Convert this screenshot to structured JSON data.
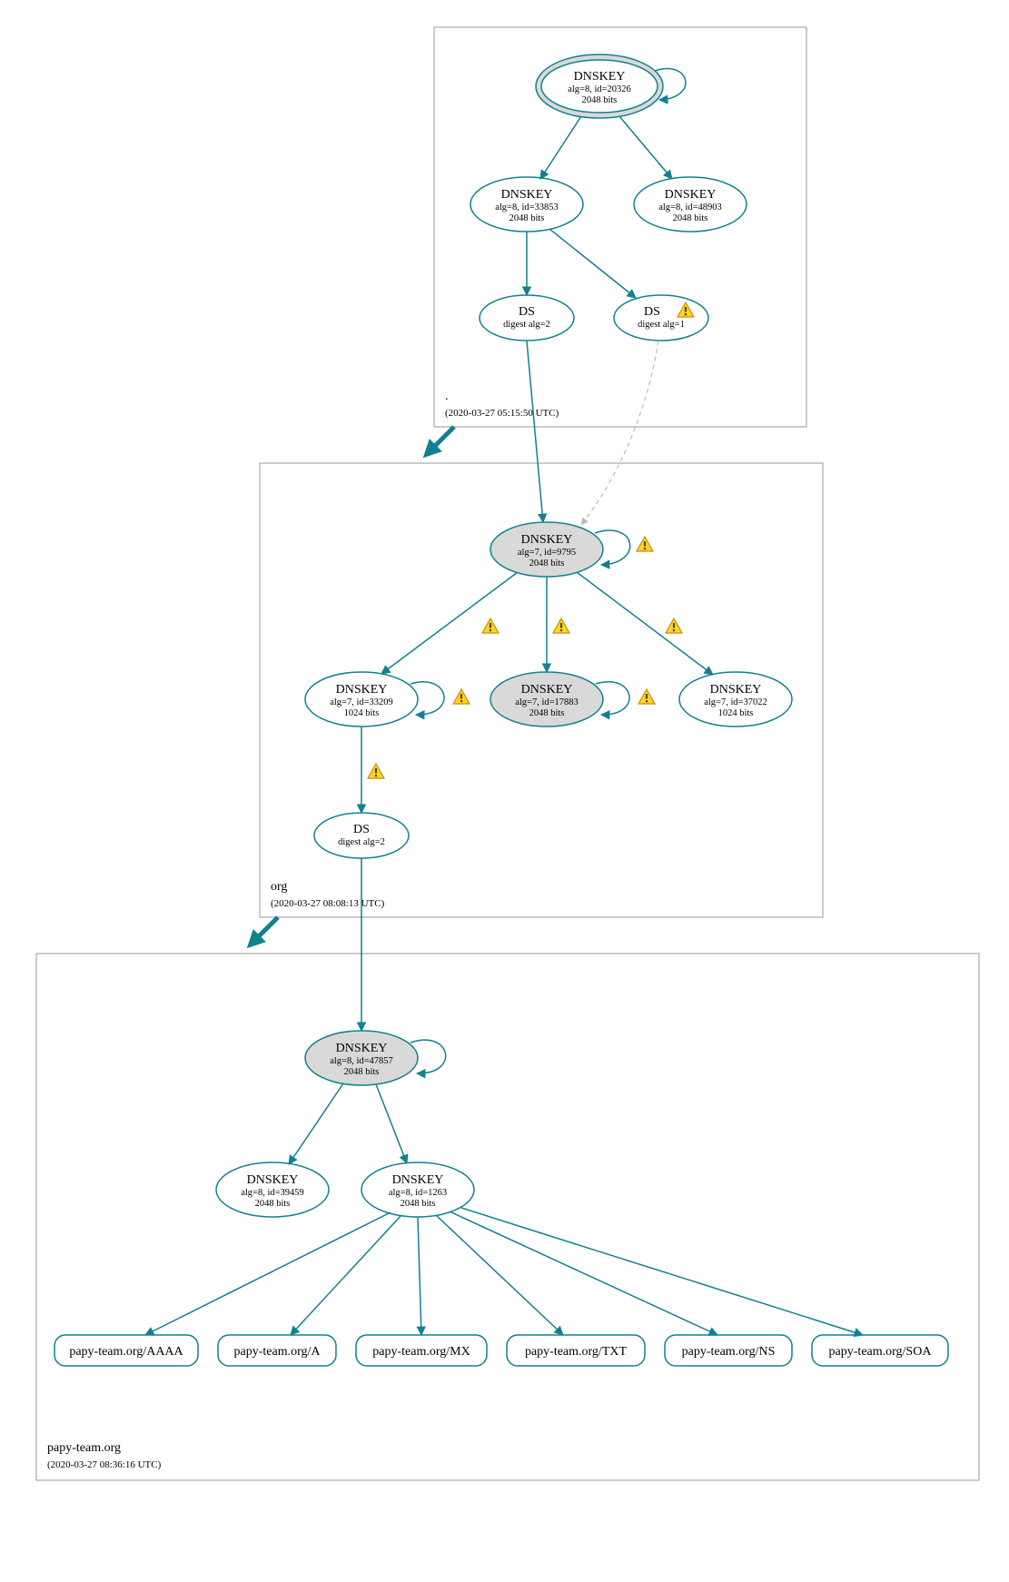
{
  "zones": {
    "root": {
      "label": ".",
      "time": "(2020-03-27 05:15:50 UTC)"
    },
    "org": {
      "label": "org",
      "time": "(2020-03-27 08:08:13 UTC)"
    },
    "leaf": {
      "label": "papy-team.org",
      "time": "(2020-03-27 08:36:16 UTC)"
    }
  },
  "nodes": {
    "root_ksk": {
      "title": "DNSKEY",
      "sub1": "alg=8, id=20326",
      "sub2": "2048 bits"
    },
    "root_zsk1": {
      "title": "DNSKEY",
      "sub1": "alg=8, id=33853",
      "sub2": "2048 bits"
    },
    "root_zsk2": {
      "title": "DNSKEY",
      "sub1": "alg=8, id=48903",
      "sub2": "2048 bits"
    },
    "root_ds1": {
      "title": "DS",
      "sub1": "digest alg=2"
    },
    "root_ds2": {
      "title": "DS",
      "sub1": "digest alg=1"
    },
    "org_ksk": {
      "title": "DNSKEY",
      "sub1": "alg=7, id=9795",
      "sub2": "2048 bits"
    },
    "org_zsk1": {
      "title": "DNSKEY",
      "sub1": "alg=7, id=33209",
      "sub2": "1024 bits"
    },
    "org_zsk2": {
      "title": "DNSKEY",
      "sub1": "alg=7, id=17883",
      "sub2": "2048 bits"
    },
    "org_zsk3": {
      "title": "DNSKEY",
      "sub1": "alg=7, id=37022",
      "sub2": "1024 bits"
    },
    "org_ds": {
      "title": "DS",
      "sub1": "digest alg=2"
    },
    "leaf_ksk": {
      "title": "DNSKEY",
      "sub1": "alg=8, id=47857",
      "sub2": "2048 bits"
    },
    "leaf_zsk1": {
      "title": "DNSKEY",
      "sub1": "alg=8, id=39459",
      "sub2": "2048 bits"
    },
    "leaf_zsk2": {
      "title": "DNSKEY",
      "sub1": "alg=8, id=1263",
      "sub2": "2048 bits"
    },
    "rr_aaaa": {
      "label": "papy-team.org/AAAA"
    },
    "rr_a": {
      "label": "papy-team.org/A"
    },
    "rr_mx": {
      "label": "papy-team.org/MX"
    },
    "rr_txt": {
      "label": "papy-team.org/TXT"
    },
    "rr_ns": {
      "label": "papy-team.org/NS"
    },
    "rr_soa": {
      "label": "papy-team.org/SOA"
    }
  }
}
